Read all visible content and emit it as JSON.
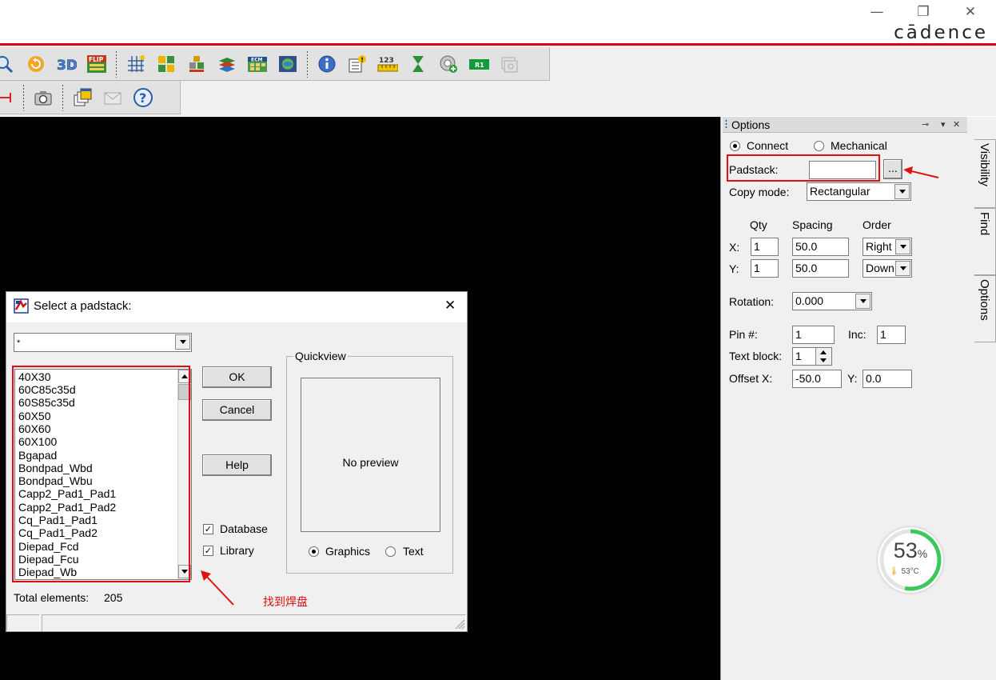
{
  "window": {
    "controls": {
      "minimize": "—",
      "restore": "❐",
      "close": "✕"
    },
    "brand": "cādence"
  },
  "toolbar": {
    "row1_icons": [
      "zoom-fit-icon",
      "refresh-icon",
      "3d-view-icon",
      "flip-icon",
      "grid-icon",
      "color-icon",
      "layer-icon",
      "stack-icon",
      "ecm-icon",
      "map-icon",
      "info-icon",
      "properties-icon",
      "measure-icon",
      "hourglass-icon",
      "add-via-icon",
      "r1-icon",
      "camera-stack-icon"
    ],
    "row1_texts": {
      "flip": "FLIP",
      "measure": "123",
      "r1": "R1",
      "ecm": "ECM"
    },
    "row2_icons": [
      "dimension-icon",
      "camera-icon",
      "windows-icon",
      "mail-icon",
      "help-icon"
    ]
  },
  "options_panel": {
    "title": "Options",
    "pin": "⊸",
    "menu": "▾",
    "close": "✕",
    "mode_connect": "Connect",
    "mode_mechanical": "Mechanical",
    "padstack_label": "Padstack:",
    "padstack_value": "",
    "browse_label": "...",
    "copy_mode_label": "Copy mode:",
    "copy_mode_value": "Rectangular",
    "col_qty": "Qty",
    "col_spacing": "Spacing",
    "col_order": "Order",
    "x_label": "X:",
    "x_qty": "1",
    "x_spacing": "50.0",
    "x_order": "Right",
    "y_label": "Y:",
    "y_qty": "1",
    "y_spacing": "50.0",
    "y_order": "Down",
    "rotation_label": "Rotation:",
    "rotation_value": "0.000",
    "pin_label": "Pin #:",
    "pin_value": "1",
    "inc_label": "Inc:",
    "inc_value": "1",
    "textblock_label": "Text block:",
    "textblock_value": "1",
    "offsetx_label": "Offset X:",
    "offsetx_value": "-50.0",
    "offsety_label": "Y:",
    "offsety_value": "0.0",
    "side_tabs": [
      "Visibility",
      "Find",
      "Options"
    ]
  },
  "gauge": {
    "percent": "53",
    "percent_sign": "%",
    "temperature": "53°C",
    "fraction": 0.53,
    "color": "#3cc85a"
  },
  "dialog": {
    "title": "Select a padstack:",
    "close": "✕",
    "filter_value": "*",
    "items": [
      "40X30",
      "60C85c35d",
      "60S85c35d",
      "60X50",
      "60X60",
      "60X100",
      "Bgapad",
      "Bondpad_Wbd",
      "Bondpad_Wbu",
      "Capp2_Pad1_Pad1",
      "Capp2_Pad1_Pad2",
      "Cq_Pad1_Pad1",
      "Cq_Pad1_Pad2",
      "Diepad_Fcd",
      "Diepad_Fcu",
      "Diepad_Wb"
    ],
    "ok": "OK",
    "cancel": "Cancel",
    "help": "Help",
    "database": "Database",
    "library": "Library",
    "quickview_label": "Quickview",
    "no_preview": "No preview",
    "graphics": "Graphics",
    "text": "Text",
    "total_label": "Total elements:",
    "total_value": "205"
  },
  "annotation": {
    "caption": "找到焊盘",
    "color": "#e01010"
  }
}
